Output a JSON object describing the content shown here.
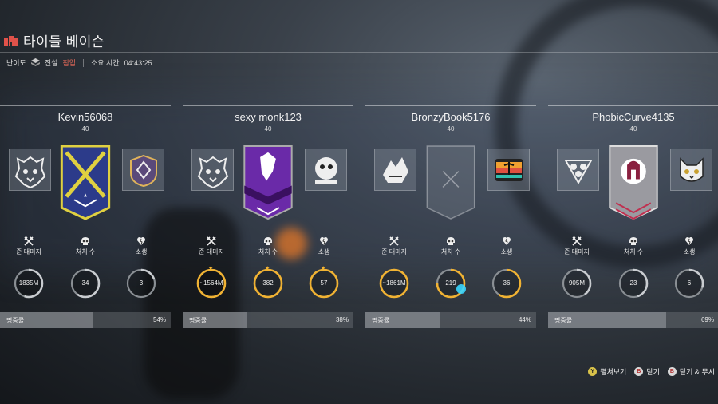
{
  "header": {
    "title": "타이들 베이슨",
    "title_icon": "stronghold-icon",
    "difficulty_label": "난이도",
    "difficulty_value": "전설",
    "difficulty_extra": "침입",
    "time_label": "소요 시간",
    "time_value": "04:43:25"
  },
  "stat_labels": {
    "damage": "준 대미지",
    "kills": "처치 수",
    "deaths": "소생"
  },
  "accuracy_label": "명중률",
  "players": [
    {
      "name": "Kevin56068",
      "level": "40",
      "emblem_left": "wolf-skull-icon",
      "banner": "blue-crossed-rifles-banner",
      "emblem_right": "shield-crest-icon",
      "damage": "1835M",
      "kills": "34",
      "deaths": "3",
      "damage_fill": 0.55,
      "kills_fill": 0.6,
      "deaths_fill": 0.2,
      "accuracy": "54%",
      "accuracy_value": 0.54,
      "starred": false
    },
    {
      "name": "sexy monk123",
      "level": "40",
      "emblem_left": "wolf-skull-icon",
      "banner": "purple-wolf-banner",
      "emblem_right": "resident-evil-badge-icon",
      "damage": "~1564M",
      "kills": "382",
      "deaths": "57",
      "damage_fill": 1.0,
      "kills_fill": 1.0,
      "deaths_fill": 1.0,
      "accuracy": "38%",
      "accuracy_value": 0.38,
      "starred": true
    },
    {
      "name": "BronzyBook5176",
      "level": "40",
      "emblem_left": "wolf-head-icon",
      "banner": "empty-banner",
      "emblem_right": "sunset-palm-icon",
      "damage": "~1861M",
      "kills": "219",
      "deaths": "36",
      "damage_fill": 1.0,
      "kills_fill": 0.75,
      "deaths_fill": 0.6,
      "accuracy": "44%",
      "accuracy_value": 0.44,
      "starred": false
    },
    {
      "name": "PhobicCurve4135",
      "level": "40",
      "emblem_left": "triple-skull-icon",
      "banner": "spartan-helmet-banner",
      "emblem_right": "cat-face-icon",
      "damage": "905M",
      "kills": "23",
      "deaths": "6",
      "damage_fill": 0.4,
      "kills_fill": 0.45,
      "deaths_fill": 0.3,
      "accuracy": "69%",
      "accuracy_value": 0.69,
      "starred": false
    }
  ],
  "footer": {
    "expand": {
      "button": "Y",
      "label": "펼쳐보기"
    },
    "close": {
      "button": "B",
      "label": "닫기"
    },
    "close_ignore": {
      "button": "B",
      "label": "닫기 & 무시"
    }
  },
  "colors": {
    "ring_gold": "#f0b233",
    "ring_track": "#8a8f94",
    "ring_active": "#3ad6ff",
    "accent_red": "#e86a5a"
  }
}
